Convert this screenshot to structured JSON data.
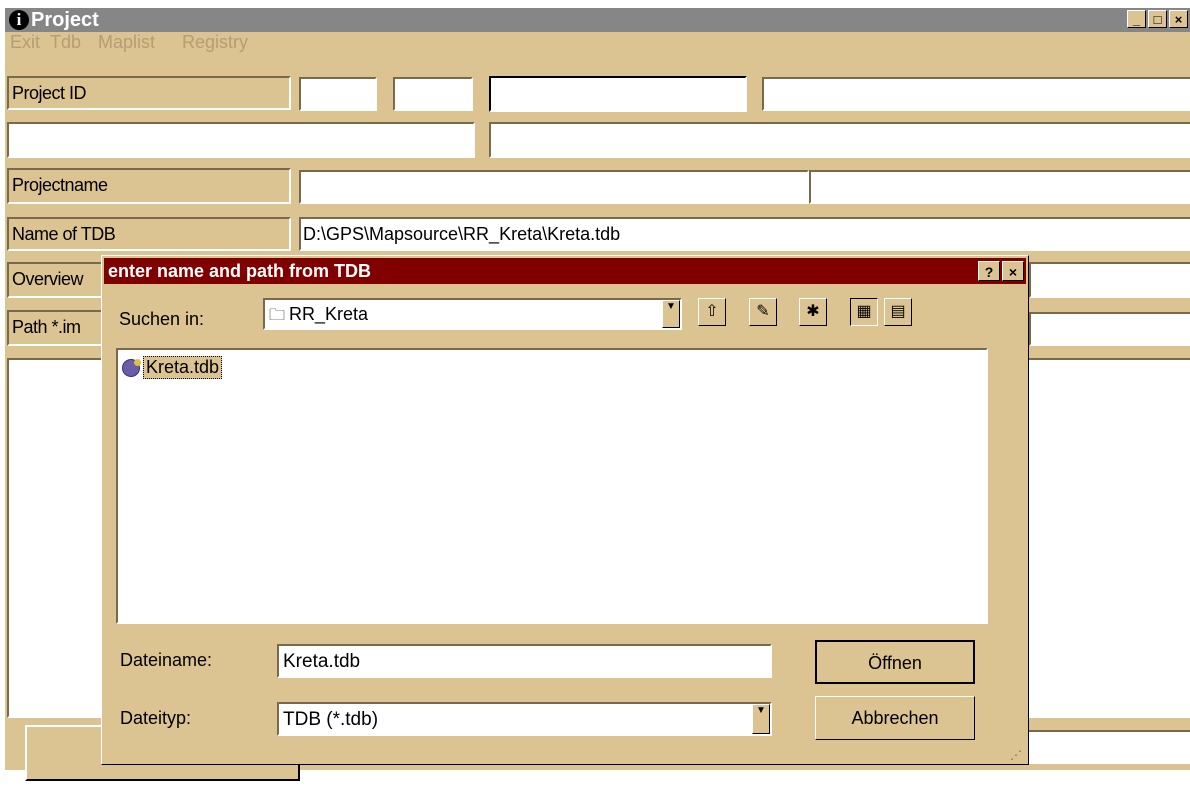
{
  "window": {
    "title": "Project",
    "info_icon_glyph": "i",
    "minimize_glyph": "_",
    "maximize_glyph": "□",
    "close_glyph": "×"
  },
  "menu": [
    {
      "label": "Exit",
      "underline": "E",
      "rest": "xit"
    },
    {
      "label": "Tdb"
    },
    {
      "label": "Maplist"
    },
    {
      "label": "Registry"
    }
  ],
  "form": {
    "project_id_label": "Project ID",
    "projectname_label": "Projectname",
    "name_of_tdb_label": "Name of TDB",
    "name_of_tdb_value": "D:\\GPS\\Mapsource\\RR_Kreta\\Kreta.tdb",
    "overview_label": "Overview",
    "path_img_label": "Path *.im"
  },
  "dialog": {
    "title": "enter name and path from TDB",
    "help_glyph": "?",
    "close_glyph": "×",
    "look_in_label": "Suchen in:",
    "look_in_value": "RR_Kreta",
    "files": [
      {
        "name": "Kreta.tdb",
        "icon": "tdb-file-icon"
      }
    ],
    "filename_label": "Dateiname:",
    "filename_value": "Kreta.tdb",
    "filetype_label": "Dateityp:",
    "filetype_value": "TDB (*.tdb)",
    "open_button": "Öffnen",
    "cancel_button": "Abbrechen"
  },
  "colors": {
    "window_bg": "#dcc392",
    "titlebar_inactive": "#868686",
    "dialog_titlebar": "#800000",
    "menu_disabled_text": "#b49e72"
  }
}
